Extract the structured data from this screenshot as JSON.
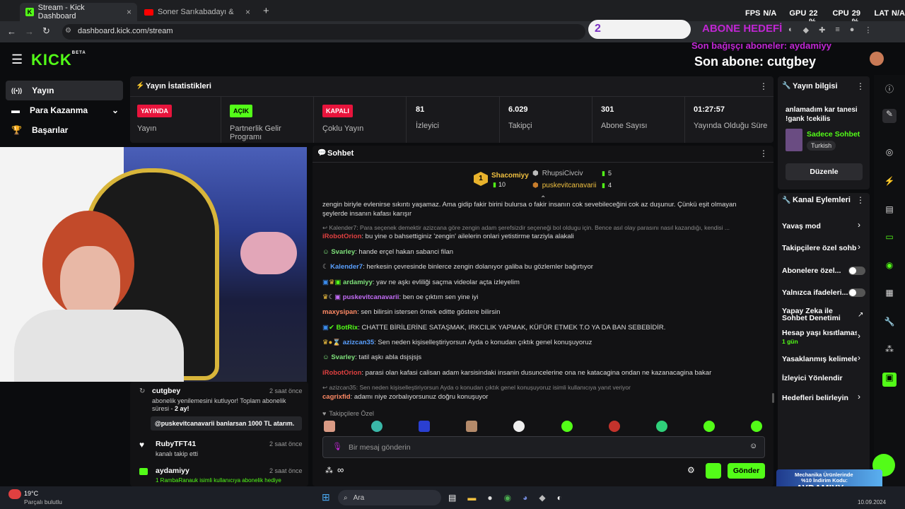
{
  "browser": {
    "tabs": [
      {
        "title": "Stream - Kick Dashboard",
        "close": "×"
      },
      {
        "title": "Soner Sarıkabadayı & Sefo & ...",
        "close": "×"
      }
    ],
    "new_tab": "+",
    "url": "dashboard.kick.com/stream",
    "overlay": {
      "fps_label": "FPS",
      "fps": "N/A",
      "gpu_label": "GPU",
      "gpu": "22 %",
      "cpu_label": "CPU",
      "cpu": "29 %",
      "lat_label": "LAT",
      "lat": "N/A"
    }
  },
  "stream_overlay": {
    "sub_goal_count": "2",
    "sub_goal_label": "ABONE HEDEFİ",
    "last_donor": "Son bağışçı aboneler: aydamiyy",
    "last_sub": "Son abone: cutgbey"
  },
  "header": {
    "logo": "KICK",
    "logo_sup": "BETA"
  },
  "sidebar": {
    "items": [
      {
        "label": "Yayın"
      },
      {
        "label": "Para Kazanma"
      },
      {
        "label": "Başarılar"
      }
    ]
  },
  "stats": {
    "title": "Yayın İstatistikleri",
    "cells": [
      {
        "badge": "YAYINDA",
        "label": "Yayın"
      },
      {
        "badge": "AÇIK",
        "label": "Partnerlik Gelir Programı"
      },
      {
        "badge": "KAPALI",
        "label": "Çoklu Yayın"
      },
      {
        "value": "81",
        "label": "İzleyici"
      },
      {
        "value": "6.029",
        "label": "Takipçi"
      },
      {
        "value": "301",
        "label": "Abone Sayısı"
      },
      {
        "value": "01:27:57",
        "label": "Yayında Olduğu Süre"
      }
    ]
  },
  "chat": {
    "title": "Sohbet",
    "top": [
      {
        "rank": "1",
        "name": "Shacomiyy",
        "count": "10"
      },
      {
        "name": "RhupsiCivciv",
        "count": "5"
      },
      {
        "name": "puskevitcanavarii",
        "count": "4"
      }
    ],
    "messages": [
      {
        "user": "",
        "text": "zengin biriyle evlenirse sıkıntı yaşamaz. Ama gidip fakir birini bulursa o fakir insanın cok sevebileceğini cok az duşunur. Çünkü eşit olmayan",
        "color": "#ddd"
      },
      {
        "user": "",
        "text": "şeylerde insanın kafası karışır",
        "color": "#ddd"
      },
      {
        "user": "",
        "text": "↩ Kalender7: Para seçenek demektir azizcana göre zengin adam şerefsizdir seçeneği bol oldugu için. Bence asıl olay parasını nasıl kazandığı, kendisi ...",
        "color": "#888"
      },
      {
        "user": "iRobotOrion",
        "text": ": bu yine o bahsettiginiz 'zengin' ailelerin onlari yetistirme tarziyla alakali",
        "color": "#e04040"
      },
      {
        "user": "Svarley",
        "text": ": hande erçel hakan sabanci filan",
        "color": "#7ee07a"
      },
      {
        "user": "Kalender7",
        "text": ": herkesin çevresinde binlerce zengin dolanıyor galiba bu gözlemler bağırtıyor",
        "color": "#5aa0ff"
      },
      {
        "user": "ardamiyy",
        "text": ": yav ne aşkı evliliği saçma videolar açta izleyelim",
        "color": "#7ee07a"
      },
      {
        "user": "puskevitcanavarii",
        "text": ": ben oe çıktım sen yine iyi",
        "color": "#c26cf5"
      },
      {
        "user": "maxysipan",
        "text": ": sen bilirsin istersen örnek editte göstere bilirsin",
        "color": "#ff8a65"
      },
      {
        "user": "BotRix",
        "text": ": CHATTE BİRİLERİNE SATAŞMAK, IRKCILIK YAPMAK, KÜFÜR ETMEK T.O YA DA BAN SEBEBİDİR.",
        "color": "#53fc18"
      },
      {
        "user": "azizcan35",
        "text": ": Sen neden kişiselleştiriyorsun Ayda o konudan çıktık genel konuşuyoruz",
        "color": "#5aa0ff"
      },
      {
        "user": "Svarley",
        "text": ": tatil aşkı abla dsjsjsjs",
        "color": "#7ee07a"
      },
      {
        "user": "iRobotOrion",
        "text": ": parasi olan kafasi calisan adam karsisindaki insanin dusuncelerine ona ne katacagina ondan ne kazanacagina bakar",
        "color": "#e04040"
      },
      {
        "user": "",
        "text": "↩ azizcan35: Sen neden kişiselleştiriyorsun Ayda o konudan çıktık genel konuşuyoruz isimli kullanıcıya yanıt veriyor",
        "color": "#888"
      },
      {
        "user": "cagrixfid",
        "text": ": adamı niye zorbalıyorsunuz doğru konuşuyor",
        "color": "#ff8a65"
      }
    ],
    "followers_label": "Takipçilere Özel",
    "input_placeholder": "Bir mesaj gönderin",
    "send": "Gönder"
  },
  "activity": [
    {
      "user": "cutgbey",
      "time": "2 saat önce",
      "text": "abonelik yenilemesini kutluyor! Toplam abonelik süresi -",
      "extra": "2 ay!",
      "quote": "@puskevitcanavarii banlarsan 1000 TL atarım."
    },
    {
      "user": "RubyTFT41",
      "time": "2 saat önce",
      "text": "kanalı takip etti"
    },
    {
      "user": "aydamiyy",
      "time": "2 saat önce",
      "text": "1 RambaRanauk isimli kullanıcıya abonelik hediye"
    }
  ],
  "stream_info": {
    "title": "Yayın bilgisi",
    "stream_title": "anlamadım kar tanesi !gank !cekilis",
    "category": "Sadece Sohbet",
    "language": "Turkish",
    "edit": "Düzenle"
  },
  "channel_actions": {
    "title": "Kanal Eylemleri",
    "items": [
      {
        "label": "Yavaş mod"
      },
      {
        "label": "Takipçilere özel sohb"
      },
      {
        "label": "Abonelere özel..."
      },
      {
        "label": "Yalnızca ifadeleri..."
      },
      {
        "label": "Yapay Zeka ile Sohbet Denetimi"
      },
      {
        "label": "Hesap yaşı kısıtlaması",
        "sub": "1 gün"
      },
      {
        "label": "Yasaklanmış kelimele"
      },
      {
        "label": "İzleyici Yönlendir"
      },
      {
        "label": "Hedefleri belirleyin"
      }
    ]
  },
  "taskbar": {
    "weather": "19°C",
    "weather_desc": "Parçalı bulutlu",
    "search": "Ara",
    "promo1": "Mechanika Ürünlerinde",
    "promo2": "%10 İndirim Kodu:",
    "promo3": "AYDAMIYY",
    "date": "10.09.2024"
  },
  "colors": {
    "accent": "#53fc18",
    "live": "#e8143c",
    "panel": "#19191c"
  }
}
